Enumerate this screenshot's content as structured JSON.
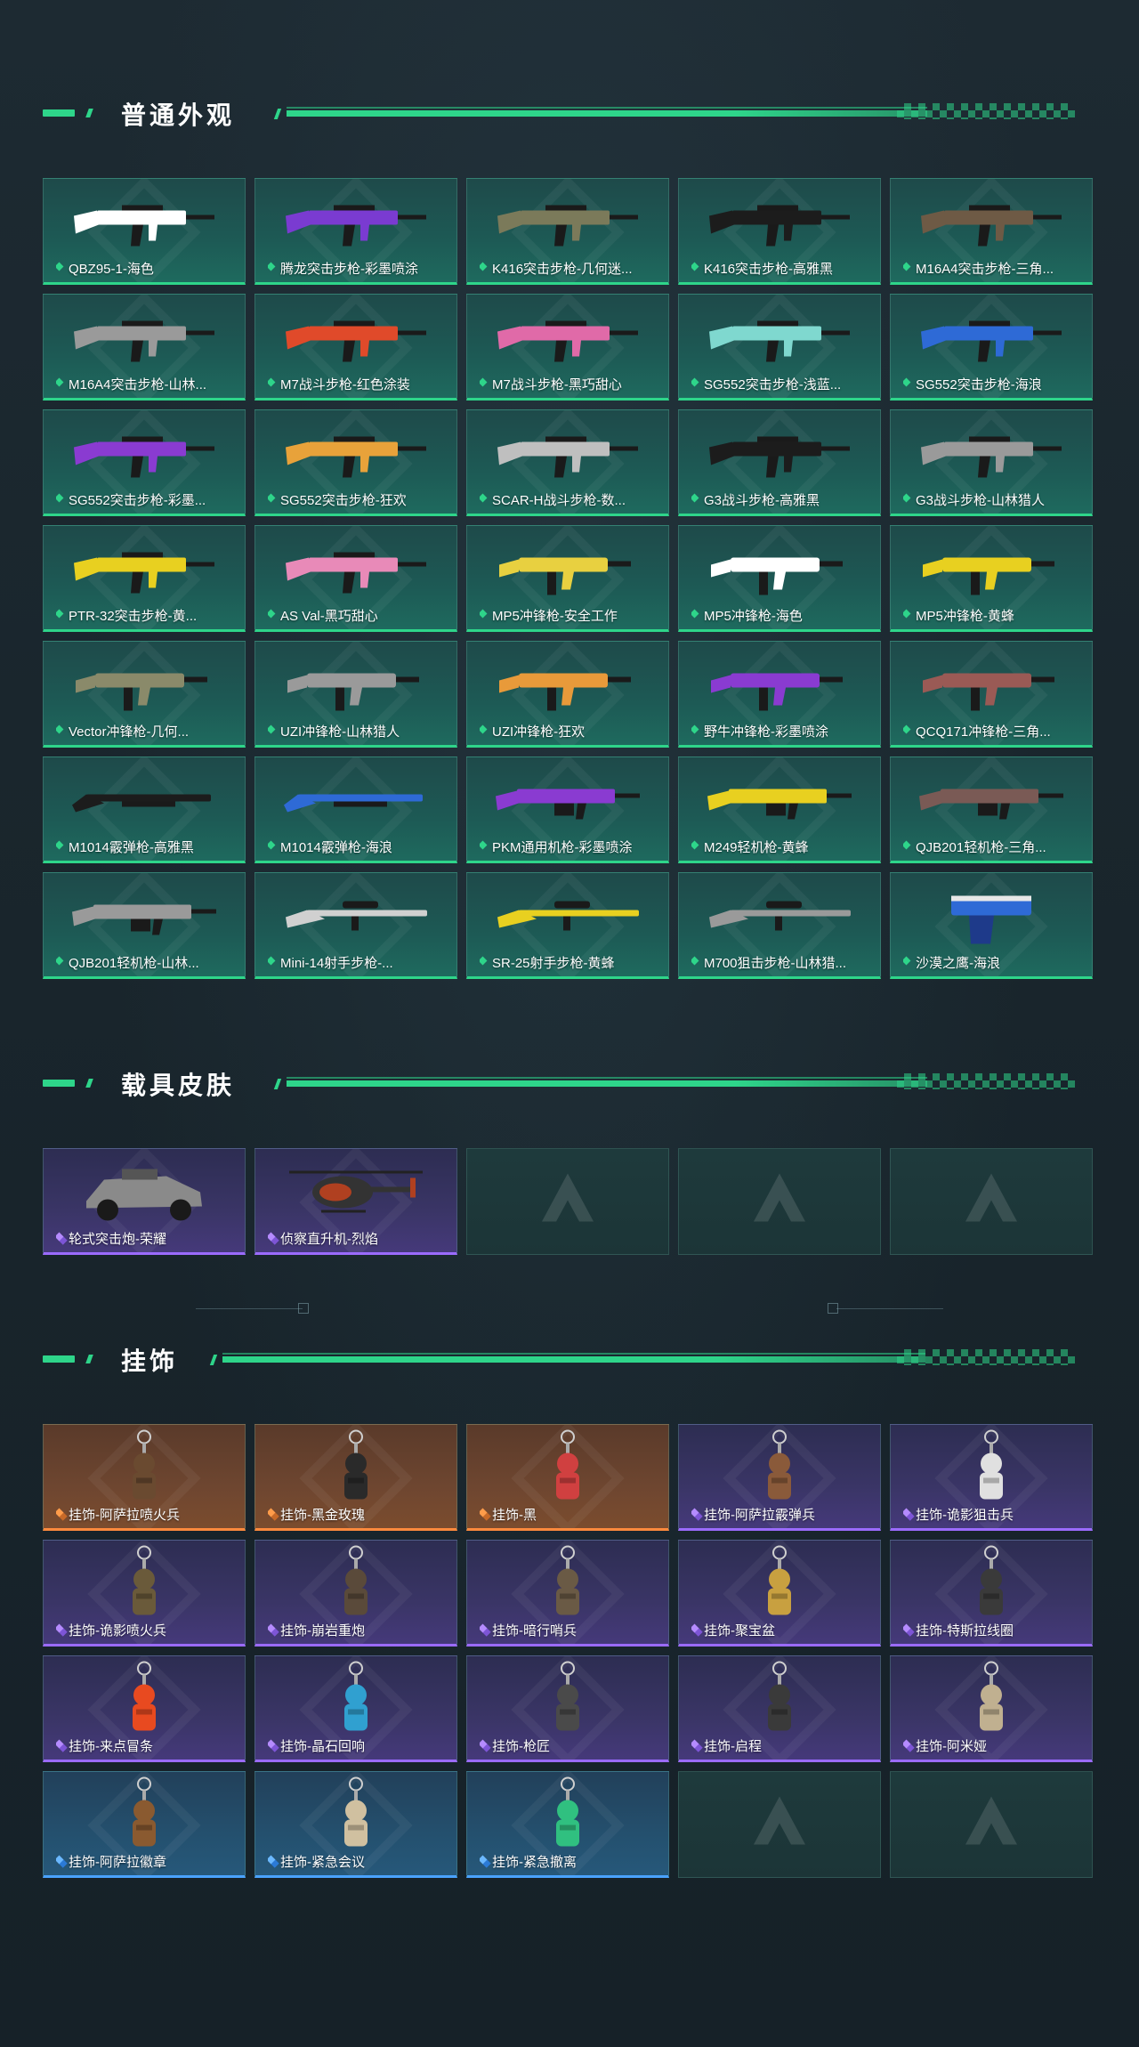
{
  "sections": {
    "weapons": {
      "title": "普通外观",
      "items": [
        {
          "label": "QBZ95-1-海色",
          "rarity": "green",
          "icon": "rifle-icon",
          "color": "#ffffff"
        },
        {
          "label": "腾龙突击步枪-彩墨喷涂",
          "rarity": "green",
          "icon": "rifle-icon",
          "color": "#7a3bd1"
        },
        {
          "label": "K416突击步枪-几何迷...",
          "rarity": "green",
          "icon": "rifle-icon",
          "color": "#7b7a5a"
        },
        {
          "label": "K416突击步枪-高雅黑",
          "rarity": "green",
          "icon": "rifle-icon",
          "color": "#1c1c1c"
        },
        {
          "label": "M16A4突击步枪-三角...",
          "rarity": "green",
          "icon": "rifle-icon",
          "color": "#6e5a45"
        },
        {
          "label": "M16A4突击步枪-山林...",
          "rarity": "green",
          "icon": "rifle-icon",
          "color": "#9a9a9a"
        },
        {
          "label": "M7战斗步枪-红色涂装",
          "rarity": "green",
          "icon": "rifle-icon",
          "color": "#e04a2a"
        },
        {
          "label": "M7战斗步枪-黑巧甜心",
          "rarity": "green",
          "icon": "rifle-icon",
          "color": "#e06aa8"
        },
        {
          "label": "SG552突击步枪-浅蓝...",
          "rarity": "green",
          "icon": "rifle-icon",
          "color": "#7fd8cf"
        },
        {
          "label": "SG552突击步枪-海浪",
          "rarity": "green",
          "icon": "rifle-icon",
          "color": "#2e6ad6"
        },
        {
          "label": "SG552突击步枪-彩墨...",
          "rarity": "green",
          "icon": "rifle-icon",
          "color": "#8a3bd1"
        },
        {
          "label": "SG552突击步枪-狂欢",
          "rarity": "green",
          "icon": "rifle-icon",
          "color": "#e8a23a"
        },
        {
          "label": "SCAR-H战斗步枪-数...",
          "rarity": "green",
          "icon": "rifle-icon",
          "color": "#bfbfbf"
        },
        {
          "label": "G3战斗步枪-高雅黑",
          "rarity": "green",
          "icon": "rifle-icon",
          "color": "#1c1c1c"
        },
        {
          "label": "G3战斗步枪-山林猎人",
          "rarity": "green",
          "icon": "rifle-icon",
          "color": "#9a9a9a"
        },
        {
          "label": "PTR-32突击步枪-黄...",
          "rarity": "green",
          "icon": "rifle-icon",
          "color": "#e8d020"
        },
        {
          "label": "AS Val-黑巧甜心",
          "rarity": "green",
          "icon": "rifle-icon",
          "color": "#e88ab8"
        },
        {
          "label": "MP5冲锋枪-安全工作",
          "rarity": "green",
          "icon": "smg-icon",
          "color": "#e8d040"
        },
        {
          "label": "MP5冲锋枪-海色",
          "rarity": "green",
          "icon": "smg-icon",
          "color": "#ffffff"
        },
        {
          "label": "MP5冲锋枪-黄蜂",
          "rarity": "green",
          "icon": "smg-icon",
          "color": "#e8d020"
        },
        {
          "label": "Vector冲锋枪-几何...",
          "rarity": "green",
          "icon": "smg-icon",
          "color": "#8a8a6a"
        },
        {
          "label": "UZI冲锋枪-山林猎人",
          "rarity": "green",
          "icon": "smg-icon",
          "color": "#9a9a9a"
        },
        {
          "label": "UZI冲锋枪-狂欢",
          "rarity": "green",
          "icon": "smg-icon",
          "color": "#e89a3a"
        },
        {
          "label": "野牛冲锋枪-彩墨喷涂",
          "rarity": "green",
          "icon": "smg-icon",
          "color": "#8a3bd1"
        },
        {
          "label": "QCQ171冲锋枪-三角...",
          "rarity": "green",
          "icon": "smg-icon",
          "color": "#9a5a55"
        },
        {
          "label": "M1014霰弹枪-高雅黑",
          "rarity": "green",
          "icon": "shotgun-icon",
          "color": "#1c1c1c"
        },
        {
          "label": "M1014霰弹枪-海浪",
          "rarity": "green",
          "icon": "shotgun-icon",
          "color": "#2e6ad6"
        },
        {
          "label": "PKM通用机枪-彩墨喷涂",
          "rarity": "green",
          "icon": "mg-icon",
          "color": "#8a3bd1"
        },
        {
          "label": "M249轻机枪-黄蜂",
          "rarity": "green",
          "icon": "mg-icon",
          "color": "#e8d020"
        },
        {
          "label": "QJB201轻机枪-三角...",
          "rarity": "green",
          "icon": "mg-icon",
          "color": "#7a5a55"
        },
        {
          "label": "QJB201轻机枪-山林...",
          "rarity": "green",
          "icon": "mg-icon",
          "color": "#9a9a9a"
        },
        {
          "label": "Mini-14射手步枪-...",
          "rarity": "green",
          "icon": "marksman-rifle-icon",
          "color": "#d0d0d0"
        },
        {
          "label": "SR-25射手步枪-黄蜂",
          "rarity": "green",
          "icon": "marksman-rifle-icon",
          "color": "#e8d020"
        },
        {
          "label": "M700狙击步枪-山林猎...",
          "rarity": "green",
          "icon": "sniper-rifle-icon",
          "color": "#9a9a9a"
        },
        {
          "label": "沙漠之鹰-海浪",
          "rarity": "green",
          "icon": "pistol-icon",
          "color": "#2e6ad6"
        }
      ]
    },
    "vehicles": {
      "title": "载具皮肤",
      "items": [
        {
          "label": "轮式突击炮-荣耀",
          "rarity": "purple",
          "icon": "vehicle-icon",
          "color": "#8a8a8a"
        },
        {
          "label": "侦察直升机-烈焰",
          "rarity": "purple",
          "icon": "helicopter-icon",
          "color": "#b04020"
        },
        {
          "label": "",
          "rarity": "empty",
          "icon": "",
          "color": ""
        },
        {
          "label": "",
          "rarity": "empty",
          "icon": "",
          "color": ""
        },
        {
          "label": "",
          "rarity": "empty",
          "icon": "",
          "color": ""
        }
      ]
    },
    "charms": {
      "title": "挂饰",
      "items": [
        {
          "label": "挂饰-阿萨拉喷火兵",
          "rarity": "orange",
          "icon": "charm-icon",
          "color": "#6a4a30"
        },
        {
          "label": "挂饰-黑金玫瑰",
          "rarity": "orange",
          "icon": "charm-icon",
          "color": "#2a2a2a"
        },
        {
          "label": "挂饰-黑",
          "rarity": "orange",
          "icon": "charm-icon",
          "color": "#d04040"
        },
        {
          "label": "挂饰-阿萨拉霰弹兵",
          "rarity": "purple",
          "icon": "charm-icon",
          "color": "#8a5a3a"
        },
        {
          "label": "挂饰-诡影狙击兵",
          "rarity": "purple",
          "icon": "charm-icon",
          "color": "#e0e0e0"
        },
        {
          "label": "挂饰-诡影喷火兵",
          "rarity": "purple",
          "icon": "charm-icon",
          "color": "#6a5a3a"
        },
        {
          "label": "挂饰-崩岩重炮",
          "rarity": "purple",
          "icon": "charm-icon",
          "color": "#5a4a3a"
        },
        {
          "label": "挂饰-暗行哨兵",
          "rarity": "purple",
          "icon": "charm-icon",
          "color": "#6a5a45"
        },
        {
          "label": "挂饰-聚宝盆",
          "rarity": "purple",
          "icon": "charm-icon",
          "color": "#c8a040"
        },
        {
          "label": "挂饰-特斯拉线圈",
          "rarity": "purple",
          "icon": "charm-icon",
          "color": "#3a3a3a"
        },
        {
          "label": "挂饰-来点冒条",
          "rarity": "purple",
          "icon": "charm-icon",
          "color": "#e84a20"
        },
        {
          "label": "挂饰-晶石回响",
          "rarity": "purple",
          "icon": "charm-icon",
          "color": "#30a0d0"
        },
        {
          "label": "挂饰-枪匠",
          "rarity": "purple",
          "icon": "charm-icon",
          "color": "#4a4a4a"
        },
        {
          "label": "挂饰-启程",
          "rarity": "purple",
          "icon": "charm-icon",
          "color": "#3a3a3a"
        },
        {
          "label": "挂饰-阿米娅",
          "rarity": "purple",
          "icon": "charm-icon",
          "color": "#c0b090"
        },
        {
          "label": "挂饰-阿萨拉徽章",
          "rarity": "blue",
          "icon": "charm-icon",
          "color": "#8a5a30"
        },
        {
          "label": "挂饰-紧急会议",
          "rarity": "blue",
          "icon": "charm-icon",
          "color": "#d0c0a0"
        },
        {
          "label": "挂饰-紧急撤离",
          "rarity": "blue",
          "icon": "charm-icon",
          "color": "#30c080"
        },
        {
          "label": "",
          "rarity": "empty",
          "icon": "",
          "color": ""
        },
        {
          "label": "",
          "rarity": "empty",
          "icon": "",
          "color": ""
        }
      ]
    }
  },
  "accent_color": "#2ed58a"
}
